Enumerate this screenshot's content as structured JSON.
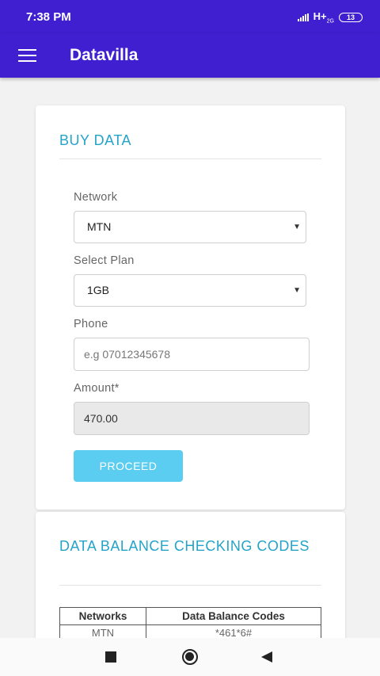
{
  "status_bar": {
    "time": "7:38 PM",
    "network": "H+",
    "network_sub": "2G",
    "battery": "13"
  },
  "app_bar": {
    "title": "Datavilla",
    "menu_icon": "hamburger-menu-icon"
  },
  "buy_data": {
    "title": "BUY DATA",
    "network_label": "Network",
    "network_value": "MTN",
    "plan_label": "Select Plan",
    "plan_value": "1GB",
    "phone_label": "Phone",
    "phone_placeholder": "e.g 07012345678",
    "amount_label": "Amount*",
    "amount_value": "470.00",
    "proceed_label": "PROCEED"
  },
  "balance_codes": {
    "title": "DATA BALANCE CHECKING CODES",
    "headers": [
      "Networks",
      "Data Balance Codes"
    ],
    "rows": [
      [
        "MTN",
        "*461*6#"
      ]
    ]
  },
  "nav_bar": {
    "icons": [
      "recent-apps-icon",
      "home-icon",
      "back-icon"
    ]
  },
  "colors": {
    "primary": "#3f1fcf",
    "accent": "#25a3c9",
    "button": "#5bcdf0"
  }
}
